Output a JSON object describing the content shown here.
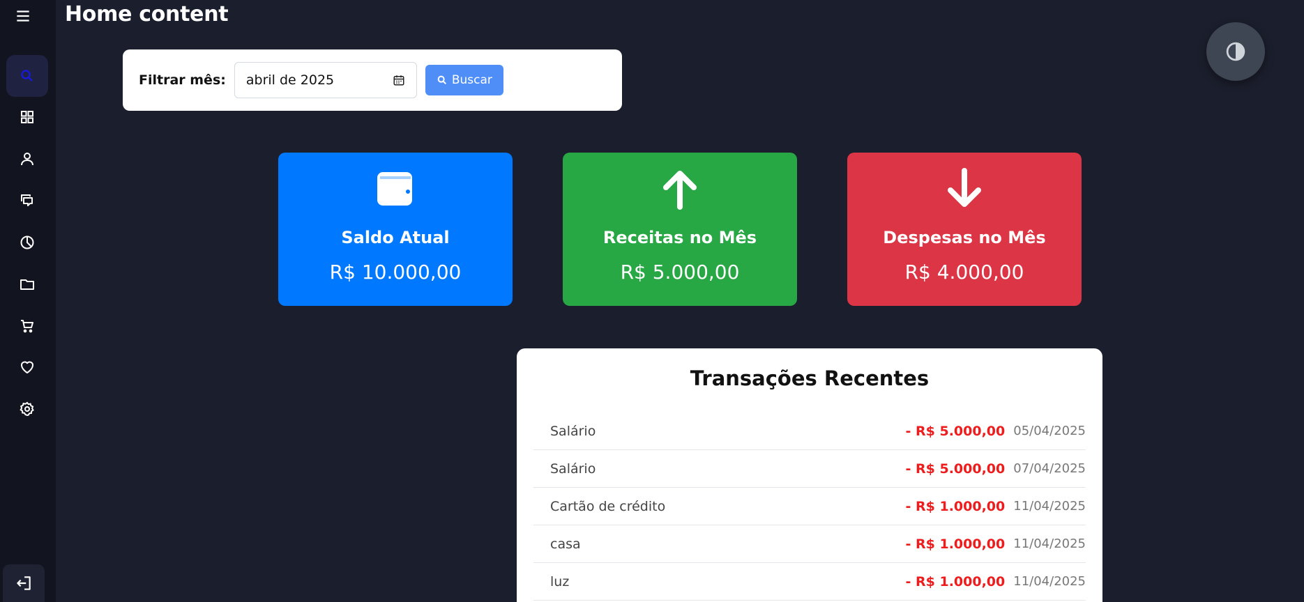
{
  "page": {
    "title": "Home content"
  },
  "sidebar": {
    "items": [
      {
        "name": "search",
        "icon": "search-icon",
        "active": true
      },
      {
        "name": "dashboard",
        "icon": "grid-icon"
      },
      {
        "name": "user",
        "icon": "user-icon"
      },
      {
        "name": "messages",
        "icon": "chat-icon"
      },
      {
        "name": "reports",
        "icon": "pie-chart-icon"
      },
      {
        "name": "files",
        "icon": "folder-icon"
      },
      {
        "name": "cart",
        "icon": "cart-icon"
      },
      {
        "name": "favorites",
        "icon": "heart-icon"
      },
      {
        "name": "settings",
        "icon": "gear-icon"
      }
    ],
    "logout_icon": "logout-icon"
  },
  "filter": {
    "label": "Filtrar mês:",
    "month_value": "abril de 2025",
    "search_label": "Buscar"
  },
  "stats": [
    {
      "label": "Saldo Atual",
      "value": "R$ 10.000,00",
      "color": "#0078ff",
      "icon": "wallet-icon"
    },
    {
      "label": "Receitas no Mês",
      "value": "R$ 5.000,00",
      "color": "#28a745",
      "icon": "arrow-up-icon"
    },
    {
      "label": "Despesas no Mês",
      "value": "R$ 4.000,00",
      "color": "#dc3545",
      "icon": "arrow-down-icon"
    }
  ],
  "transactions": {
    "title": "Transações Recentes",
    "rows": [
      {
        "desc": "Salário",
        "amount": "- R$ 5.000,00",
        "date": "05/04/2025"
      },
      {
        "desc": "Salário",
        "amount": "- R$ 5.000,00",
        "date": "07/04/2025"
      },
      {
        "desc": "Cartão de crédito",
        "amount": "- R$ 1.000,00",
        "date": "11/04/2025"
      },
      {
        "desc": "casa",
        "amount": "- R$ 1.000,00",
        "date": "11/04/2025"
      },
      {
        "desc": "luz",
        "amount": "- R$ 1.000,00",
        "date": "11/04/2025"
      }
    ]
  },
  "colors": {
    "background": "#1b1e2c",
    "sidebar": "#121420",
    "accent": "#4f8ef7",
    "negative": "#ee1c1c"
  }
}
